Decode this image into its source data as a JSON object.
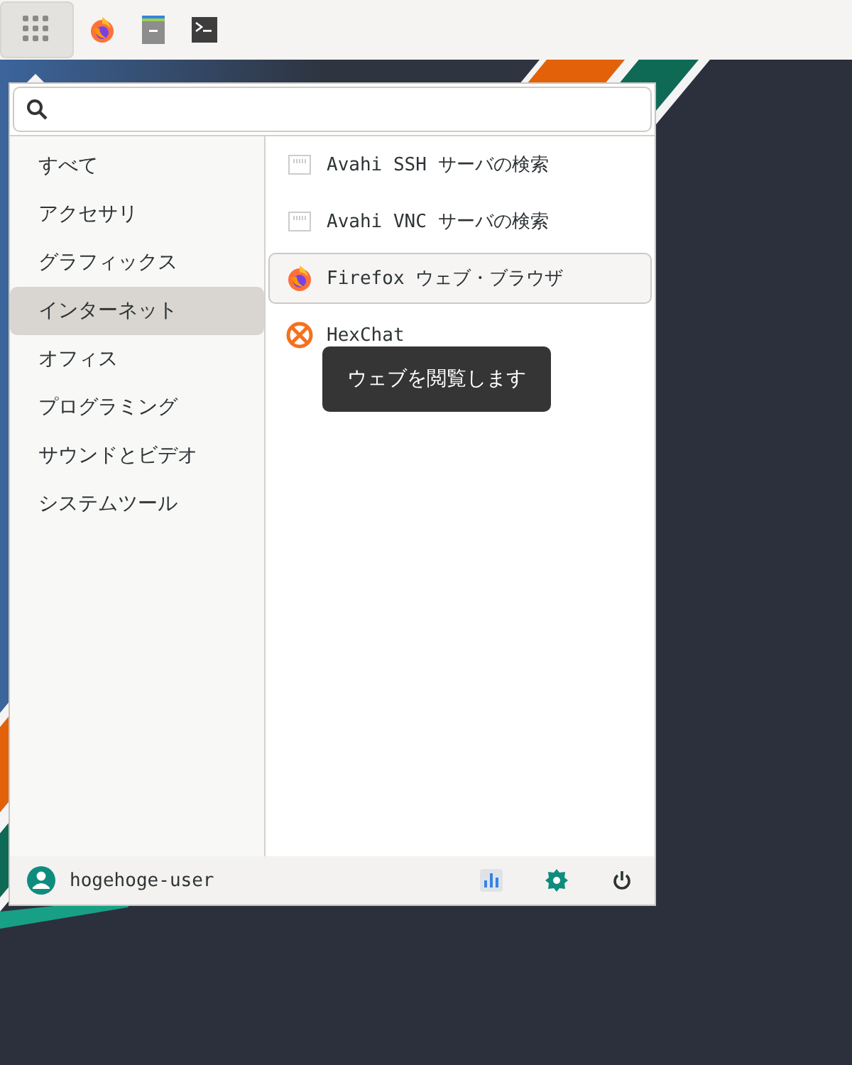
{
  "panel": {
    "apps_button": {
      "pressed": true
    }
  },
  "menu": {
    "categories": [
      {
        "label": "すべて",
        "selected": false
      },
      {
        "label": "アクセサリ",
        "selected": false
      },
      {
        "label": "グラフィックス",
        "selected": false
      },
      {
        "label": "インターネット",
        "selected": true
      },
      {
        "label": "オフィス",
        "selected": false
      },
      {
        "label": "プログラミング",
        "selected": false
      },
      {
        "label": "サウンドとビデオ",
        "selected": false
      },
      {
        "label": "システムツール",
        "selected": false
      }
    ],
    "apps": [
      {
        "label": "Avahi SSH サーバの検索",
        "kind": "network",
        "selected": false
      },
      {
        "label": "Avahi VNC サーバの検索",
        "kind": "network",
        "selected": false
      },
      {
        "label": "Firefox ウェブ・ブラウザ",
        "kind": "firefox",
        "selected": true
      },
      {
        "label": "HexChat",
        "kind": "hexchat",
        "selected": false
      }
    ],
    "tooltip": {
      "text": "ウェブを閲覧します"
    },
    "footer": {
      "user": "hogehoge-user"
    }
  }
}
